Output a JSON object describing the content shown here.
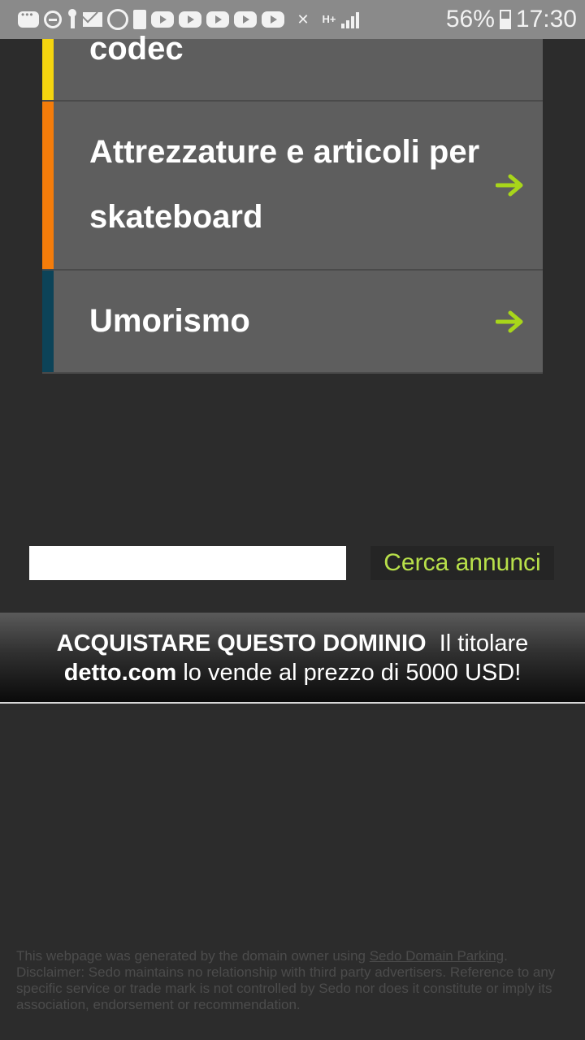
{
  "status_bar": {
    "battery_percent": "56%",
    "time": "17:30",
    "network": "H+",
    "icons": [
      "chat-icon",
      "do-not-disturb-icon",
      "key-icon",
      "mail-icon",
      "whatsapp-icon",
      "battery-saver-icon",
      "youtube-icon",
      "youtube-icon",
      "youtube-icon",
      "youtube-icon",
      "youtube-icon",
      "mute-icon",
      "network-icon",
      "signal-icon",
      "battery-icon"
    ]
  },
  "categories": [
    {
      "label": "codec",
      "color": "#f5d50f"
    },
    {
      "label": "Attrezzature e articoli per skateboard",
      "color": "#f57c0a"
    },
    {
      "label": "Umorismo",
      "color": "#0c4358"
    }
  ],
  "arrow_color": "#a8d61a",
  "search": {
    "value": "",
    "button_label": "Cerca annunci"
  },
  "banner": {
    "headline": "ACQUISTARE QUESTO DOMINIO",
    "text_before": "Il titolare",
    "domain": "detto.com",
    "text_after": "lo vende al prezzo di 5000 USD!"
  },
  "footer": {
    "line1_prefix": "This webpage was generated by the domain owner using ",
    "link": "Sedo Domain Parking",
    "line1_suffix": ".",
    "disclaimer": "Disclaimer: Sedo maintains no relationship with third party advertisers. Reference to any specific service or trade mark is not controlled by Sedo nor does it constitute or imply its association, endorsement or recommendation."
  }
}
